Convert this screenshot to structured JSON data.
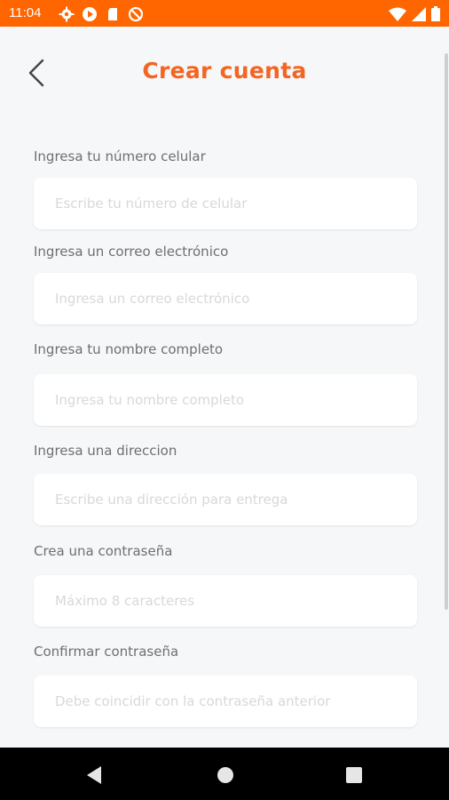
{
  "status_bar": {
    "time": "11:04",
    "icons_left": [
      "settings-icon",
      "play-icon",
      "sd-card-icon",
      "do-not-disturb-icon"
    ],
    "icons_right": [
      "wifi-icon",
      "cell-signal-icon",
      "battery-icon"
    ]
  },
  "header": {
    "title": "Crear cuenta",
    "back_icon": "chevron-left-icon"
  },
  "form": {
    "fields": [
      {
        "label": "Ingresa tu número celular",
        "placeholder": "Escribe tu número de celular",
        "value": ""
      },
      {
        "label": "Ingresa un correo electrónico",
        "placeholder": "Ingresa un correo electrónico",
        "value": ""
      },
      {
        "label": "Ingresa tu nombre completo",
        "placeholder": "Ingresa tu nombre completo",
        "value": ""
      },
      {
        "label": "Ingresa una direccion",
        "placeholder": "Escribe una dirección para entrega",
        "value": ""
      },
      {
        "label": "Crea una contraseña",
        "placeholder": "Máximo 8 caracteres",
        "value": ""
      },
      {
        "label": "Confirmar contraseña",
        "placeholder": "Debe coincidir con la contraseña anterior",
        "value": ""
      }
    ]
  },
  "nav_bar": {
    "icons": [
      "back-triangle-icon",
      "home-circle-icon",
      "recents-square-icon"
    ]
  },
  "colors": {
    "status_bar": "#ff6600",
    "title": "#f26522",
    "background": "#f6f7f9"
  }
}
